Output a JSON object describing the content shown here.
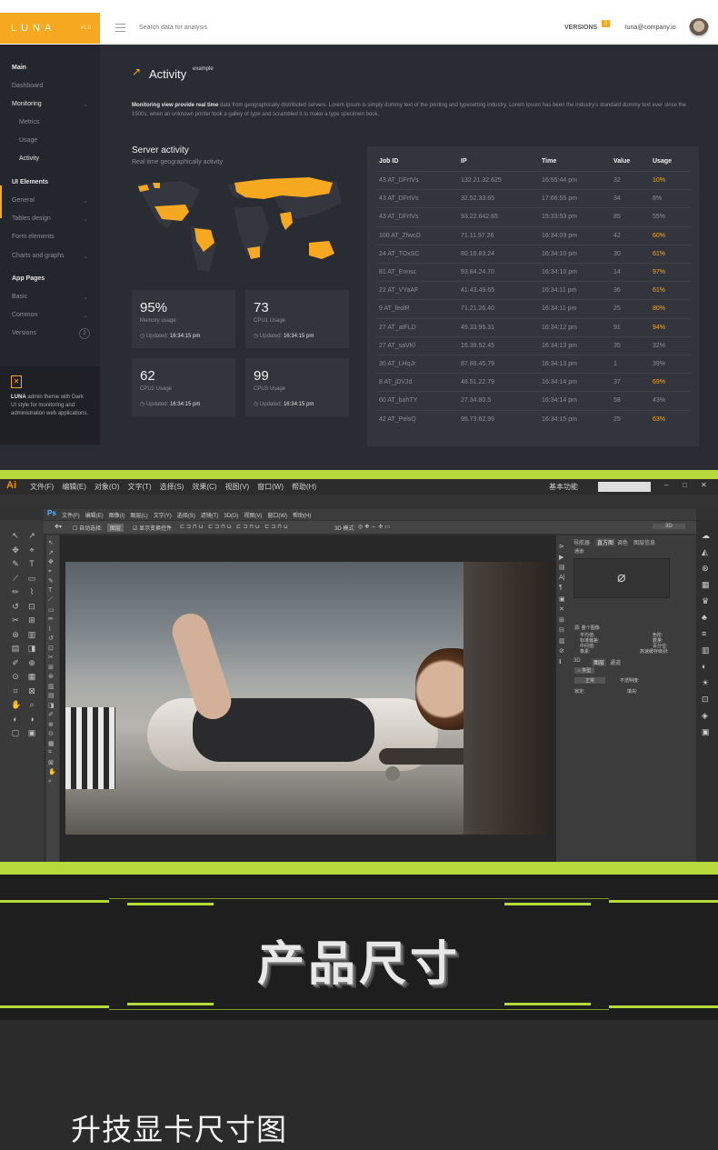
{
  "luna": {
    "brand": "LUNA",
    "version": "v1.0",
    "search_placeholder": "Search data for analysis",
    "versions_label": "VERSIONS",
    "versions_badge": "3",
    "user_email": "luna@company.io",
    "sidebar": {
      "sections": [
        {
          "label": "Main",
          "type": "head"
        },
        {
          "label": "Dashboard",
          "type": "item"
        },
        {
          "label": "Monitoring",
          "type": "active"
        },
        {
          "label": "Metrics",
          "type": "sub"
        },
        {
          "label": "Usage",
          "type": "sub"
        },
        {
          "label": "Activity",
          "type": "sub-active"
        },
        {
          "label": "UI Elements",
          "type": "head"
        },
        {
          "label": "General",
          "type": "item"
        },
        {
          "label": "Tables design",
          "type": "item"
        },
        {
          "label": "Form elements",
          "type": "item"
        },
        {
          "label": "Charts and graphs",
          "type": "item"
        },
        {
          "label": "App Pages",
          "type": "head"
        },
        {
          "label": "Basic",
          "type": "item"
        },
        {
          "label": "Common",
          "type": "item"
        },
        {
          "label": "Versions",
          "type": "item"
        }
      ],
      "versions_count": "2",
      "footer_brand": "LUNA",
      "footer_text": "admin theme with Dark UI style for monitoring and administration web applications."
    },
    "activity": {
      "title": "Activity",
      "sup": "example",
      "desc_bold": "Monitoring view provide real time",
      "desc_rest": "data from geographically distributed servers. Lorem Ipsum is simply dummy text of the printing and typesetting industry. Lorem Ipsum has been the industry's standard dummy text ever since the 1500s, when an unknown printer took a galley of type and scrambled it to make a type specimen book."
    },
    "server_activity": {
      "title": "Server activity",
      "subtitle": "Real time geographically activity"
    },
    "stats": [
      {
        "value": "95%",
        "label": "Memory usage",
        "updated_label": "Updated:",
        "time": "16:34:15 pm"
      },
      {
        "value": "73",
        "label": "CPU1 Usage",
        "updated_label": "Updated:",
        "time": "16:34:15 pm"
      },
      {
        "value": "62",
        "label": "CPU2 Usage",
        "updated_label": "Updated:",
        "time": "16:34:15 pm"
      },
      {
        "value": "99",
        "label": "CPU3 Usage",
        "updated_label": "Updated:",
        "time": "16:34:15 pm"
      }
    ],
    "table": {
      "headers": [
        "Job ID",
        "IP",
        "Time",
        "Value",
        "Usage"
      ],
      "rows": [
        [
          "43 AT_DFrtVs",
          "132.21.32.625",
          "16:55:44 pm",
          "32",
          "10%",
          true
        ],
        [
          "43 AT_DFrtVs",
          "32.52.33.65",
          "17:66:55 pm",
          "34",
          "8%",
          false
        ],
        [
          "43 AT_DFrtVs",
          "93.22.642.65",
          "15:33:53 pm",
          "85",
          "55%",
          false
        ],
        [
          "100 AT_ZfwcO",
          "71.11.97.26",
          "16:34:09 pm",
          "42",
          "60%",
          true
        ],
        [
          "24 AT_TOxSC",
          "80.16.83.24",
          "16:34:10 pm",
          "30",
          "61%",
          true
        ],
        [
          "81 AT_Ennsc",
          "93.84.24.70",
          "16:34:10 pm",
          "14",
          "97%",
          true
        ],
        [
          "22 AT_VYaAF",
          "41.43.49.65",
          "16:34:11 pm",
          "36",
          "61%",
          true
        ],
        [
          "9 AT_leolR",
          "71.21.26.40",
          "16:34:11 pm",
          "25",
          "80%",
          true
        ],
        [
          "27 AT_atFLD",
          "49.33.96.31",
          "16:34:12 pm",
          "91",
          "94%",
          true
        ],
        [
          "27 AT_saVKl",
          "16.39.52.45",
          "16:34:13 pm",
          "35",
          "32%",
          false
        ],
        [
          "30 AT_LHqJr",
          "87.88.45.79",
          "16:34:13 pm",
          "1",
          "39%",
          false
        ],
        [
          "8 AT_jDVJd",
          "48.51.22.79",
          "16:34:14 pm",
          "37",
          "69%",
          true
        ],
        [
          "60 AT_bahTY",
          "27.34.80.5",
          "16:34:14 pm",
          "58",
          "43%",
          false
        ],
        [
          "42 AT_PelsQ",
          "95.73.62.99",
          "16:34:15 pm",
          "25",
          "63%",
          true
        ]
      ]
    },
    "colors": {
      "accent": "#f6a821",
      "bg": "#2a2c33",
      "panel": "#33353c"
    }
  },
  "ps": {
    "ai_logo": "Ai",
    "ai_menu": [
      "文件(F)",
      "编辑(E)",
      "对象(O)",
      "文字(T)",
      "选择(S)",
      "效果(C)",
      "视图(V)",
      "窗口(W)",
      "帮助(H)"
    ],
    "workspace": "基本功能",
    "ps_logo": "Ps",
    "ps_menu": [
      "文件(F)",
      "编辑(E)",
      "图像(I)",
      "图层(L)",
      "文字(Y)",
      "选择(S)",
      "滤镜(T)",
      "3D(D)",
      "视图(V)",
      "窗口(W)",
      "帮助(H)"
    ],
    "options": {
      "auto_select": "自动选择:",
      "layer": "图层",
      "show_transform": "显示变换控件",
      "mode3d": "3D 模式:"
    },
    "panel_tabs": [
      "导航器",
      "直方图",
      "调色",
      "图层信息"
    ],
    "channel": "通道:",
    "stats_labels": [
      "平均值:",
      "标准偏差:",
      "中间值:",
      "像素:",
      "色阶:",
      "数量:",
      "百分位:",
      "高速缓存级别:"
    ],
    "source": "源:",
    "source_val": "整个图像",
    "layers_tabs": [
      "3D",
      "图层",
      "通道"
    ],
    "layer_kind": "类型",
    "blend": "正常",
    "opacity": "不透明度:",
    "lock": "锁定:",
    "fill": "填充:"
  },
  "banner": {
    "title": "产品尺寸"
  },
  "caption": {
    "text": "升技显卡尺寸图"
  }
}
